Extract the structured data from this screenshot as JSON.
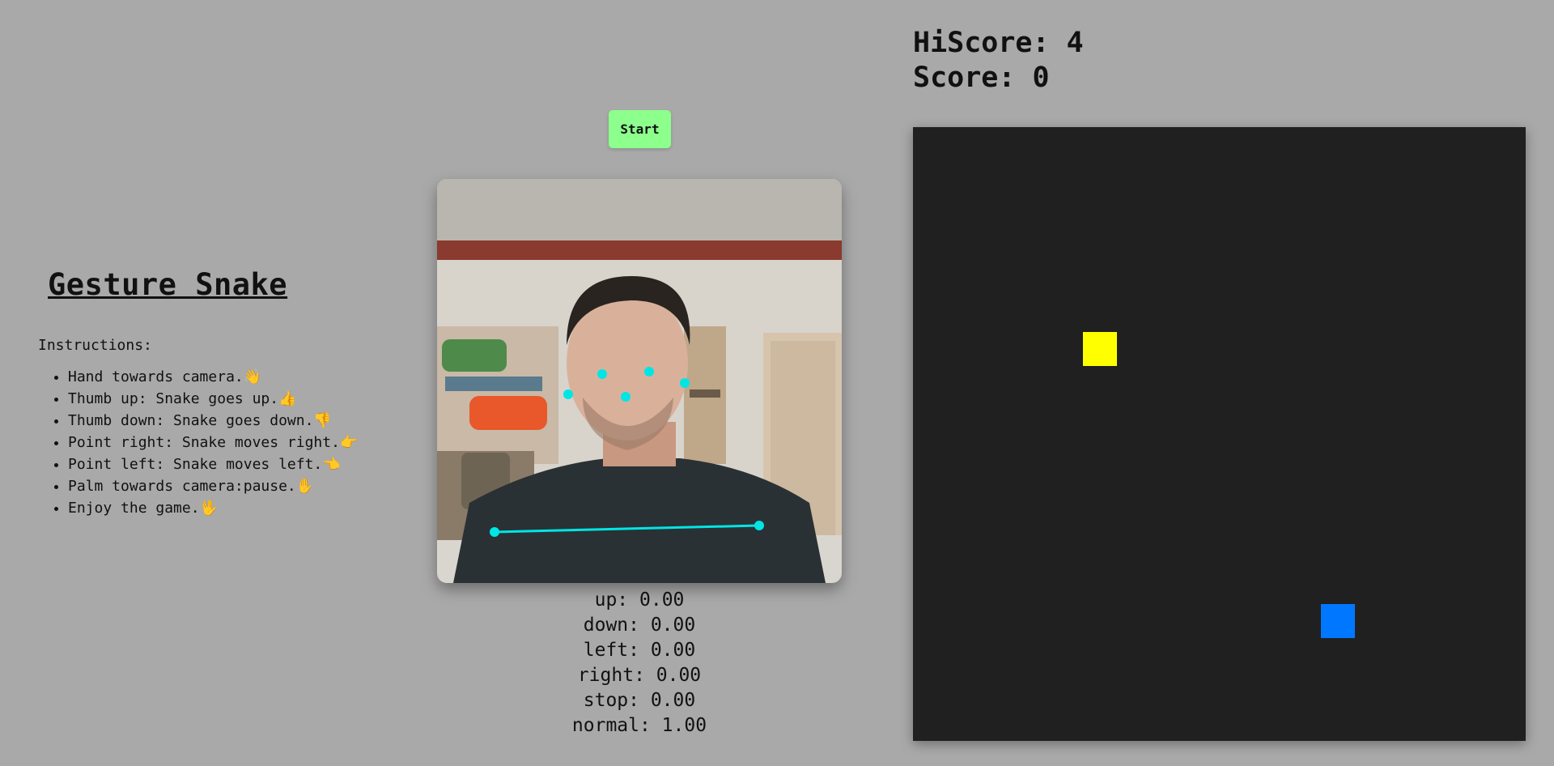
{
  "game": {
    "title": "Gesture Snake",
    "instructions_label": "Instructions:",
    "instructions": [
      "Hand towards camera.👋",
      "Thumb up: Snake goes up.👍",
      "Thumb down: Snake goes down.👎",
      "Point right: Snake moves right.👉",
      "Point left: Snake moves left.👈",
      "Palm towards camera:pause.✋",
      "Enjoy the game.🖖"
    ]
  },
  "controls": {
    "start_label": "Start"
  },
  "predictions": [
    "up: 0.00",
    "down: 0.00",
    "left: 0.00",
    "right: 0.00",
    "stop: 0.00",
    "normal: 1.00"
  ],
  "scoreboard": {
    "hiscore": "HiScore: 4",
    "score": "Score: 0"
  },
  "board": {
    "colors": {
      "background": "#202020",
      "food": "#ffff00",
      "snake": "#0077ff"
    }
  },
  "webcam": {
    "pose_keypoint_color": "#00e5e5"
  }
}
